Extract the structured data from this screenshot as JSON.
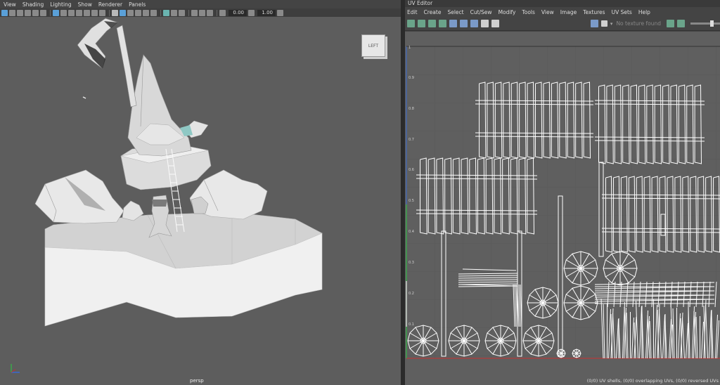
{
  "viewport": {
    "menu": [
      "View",
      "Shading",
      "Lighting",
      "Show",
      "Renderer",
      "Panels"
    ],
    "camera_label": "persp",
    "viewcube_label": "LEFT",
    "exposure": "0.00",
    "gamma": "1.00"
  },
  "uv_editor": {
    "title": "UV Editor",
    "menu": [
      "Edit",
      "Create",
      "Select",
      "Cut/Sew",
      "Modify",
      "Tools",
      "View",
      "Image",
      "Textures",
      "UV Sets",
      "Help"
    ],
    "texture_placeholder": "No texture found",
    "status": "(0/0) UV shells, (0/0) overlapping UVs, (0/0) reversed UVs",
    "v_ticks": [
      "1",
      "0.9",
      "0.8",
      "0.7",
      "0.6",
      "0.5",
      "0.4",
      "0.3",
      "0.2",
      "0.1"
    ]
  },
  "colors": {
    "viewport_bg": "#5d5d5d",
    "uv_grid_bg": "#5f5f5f",
    "uv_axis_v": "#3a6ad0",
    "uv_axis_u": "#c83030",
    "uv_axis_green": "#3aa84a",
    "selection_highlight": "#5aa0d8"
  },
  "icons": {
    "viewcube": "view-cube",
    "axis": "axis-gizmo-icon",
    "toggle_grid": "grid-icon",
    "checker": "checker-icon",
    "lock": "lock-icon",
    "camera": "camera-icon"
  }
}
